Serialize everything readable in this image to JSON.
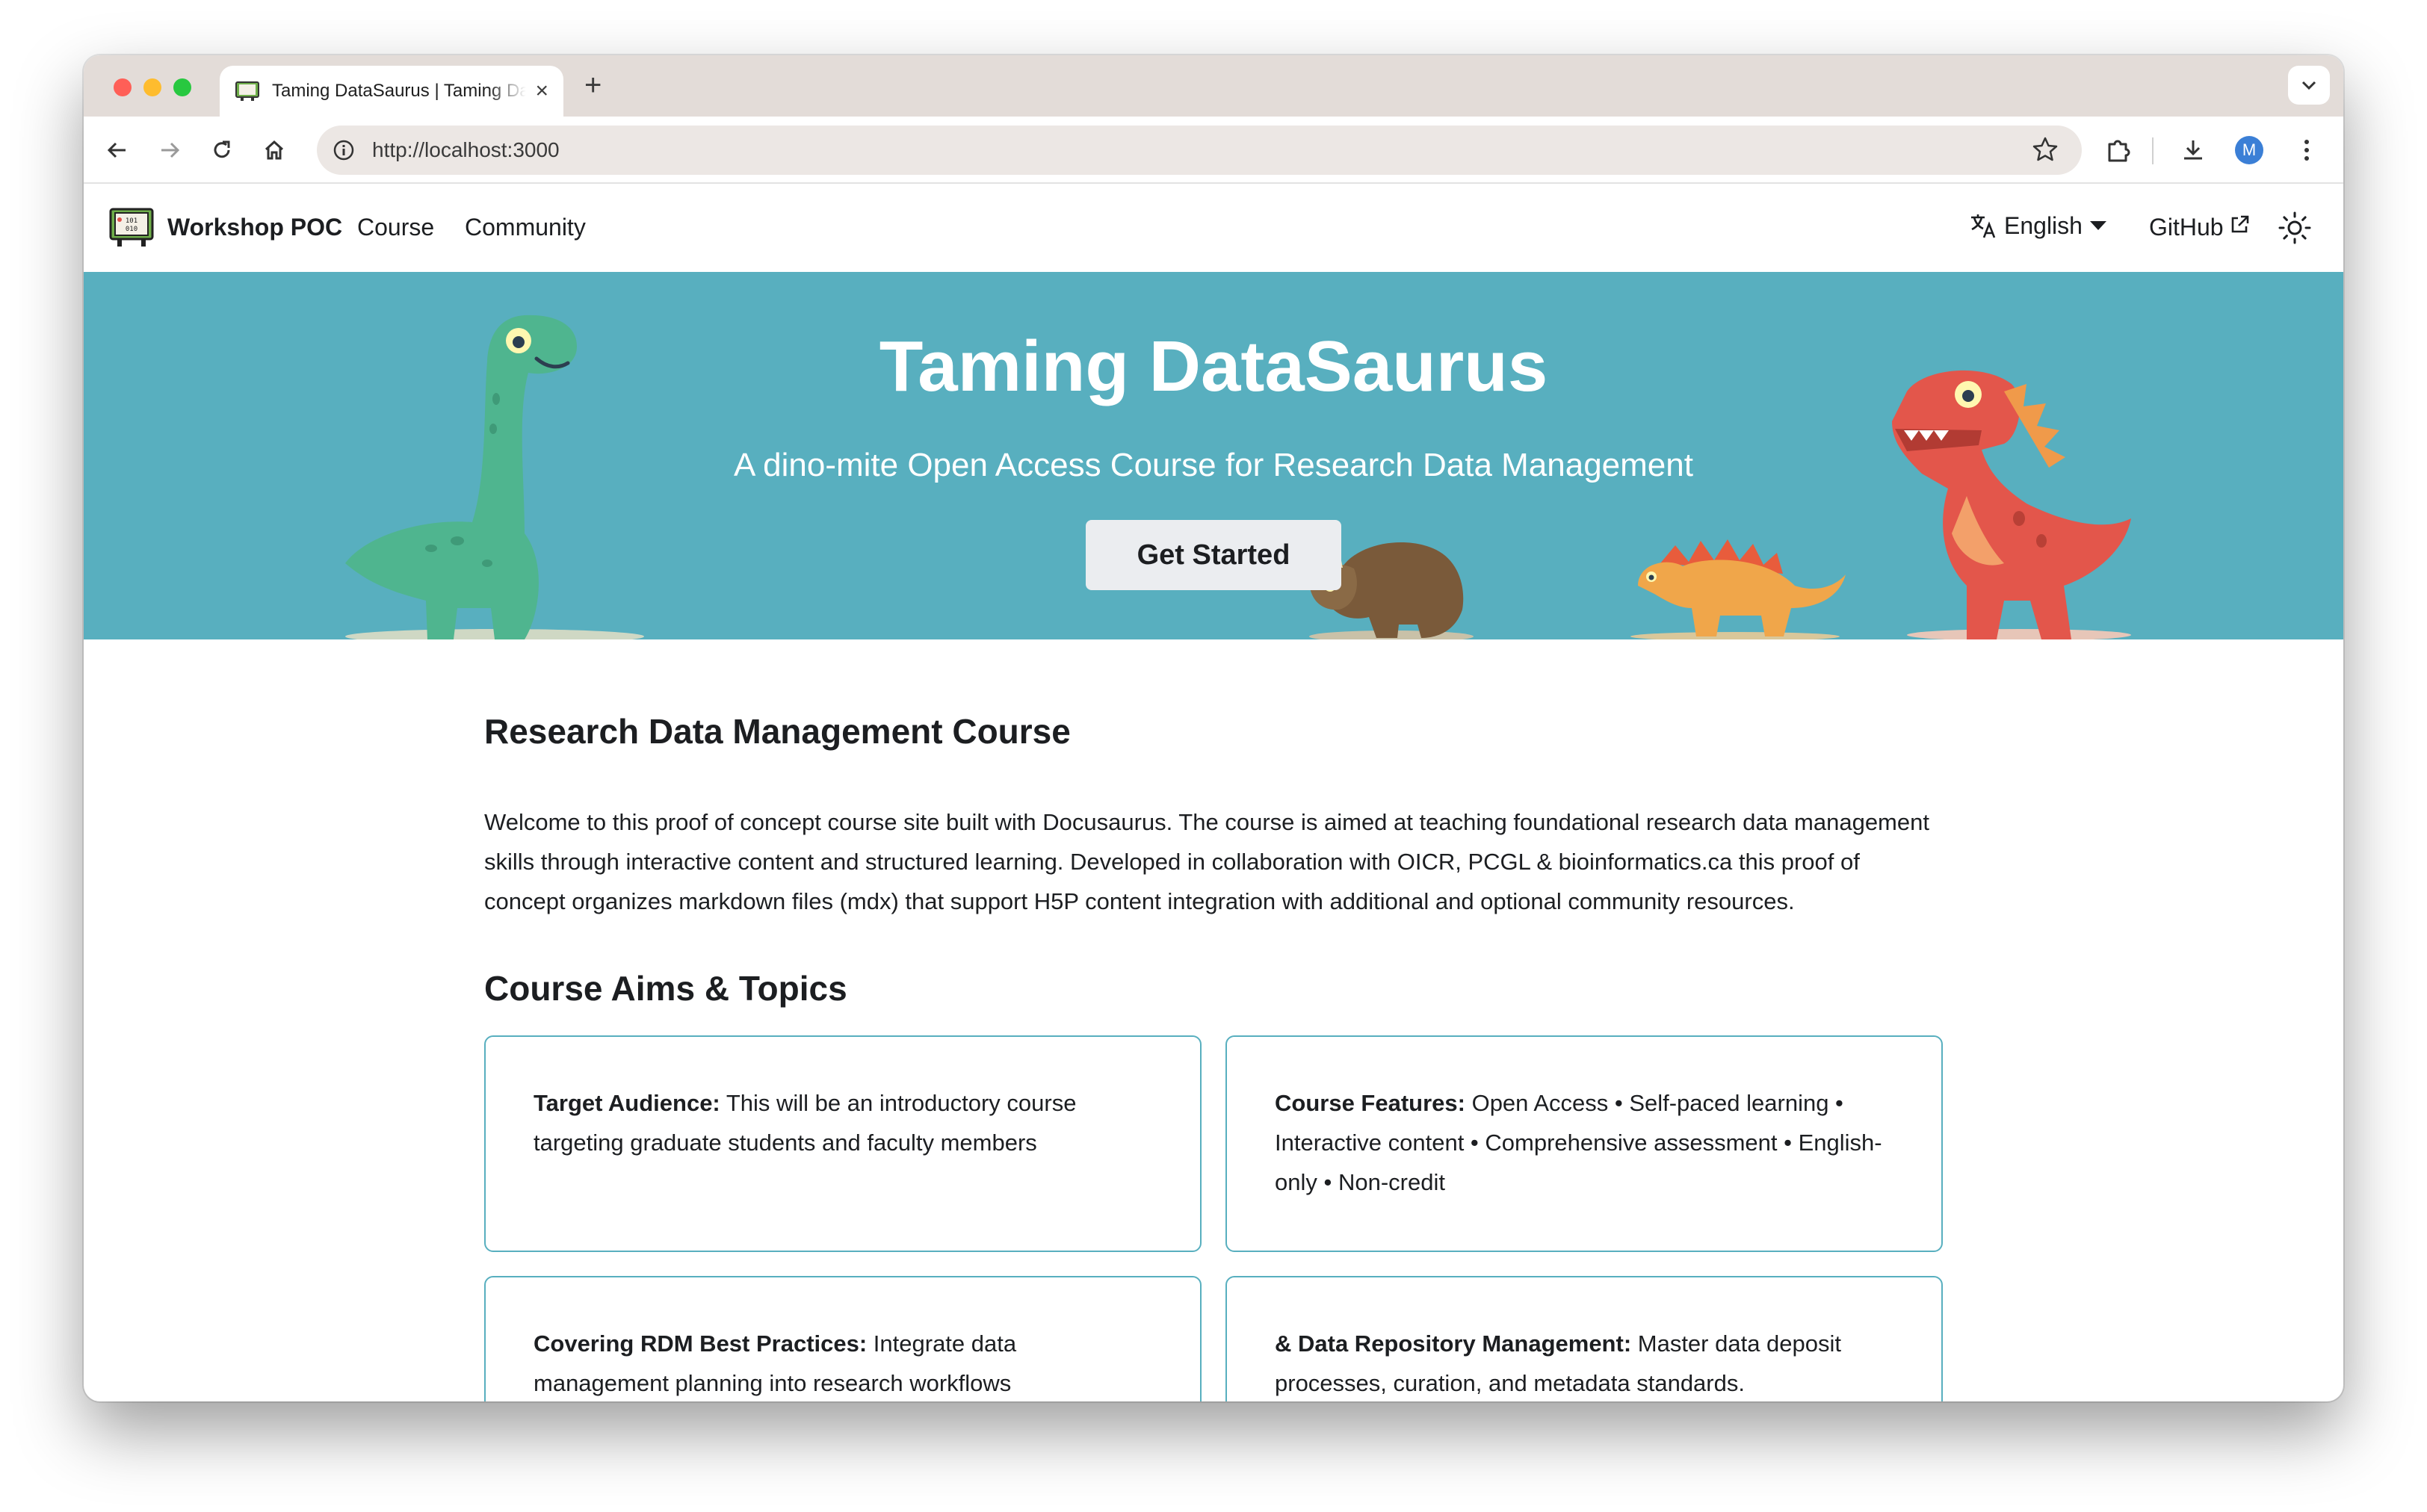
{
  "browser": {
    "tab_title": "Taming DataSaurus | Taming DataSaurus",
    "tab_close": "×",
    "new_tab": "+",
    "url": "http://localhost:3000",
    "profile_initial": "M"
  },
  "navbar": {
    "brand": "Workshop POC",
    "links": [
      "Course",
      "Community"
    ],
    "language": "English",
    "github": "GitHub"
  },
  "hero": {
    "title": "Taming DataSaurus",
    "subtitle": "A dino-mite Open Access Course for Research Data Management",
    "cta": "Get Started",
    "color": "#58afbf"
  },
  "content": {
    "heading": "Research Data Management Course",
    "intro": "Welcome to this proof of concept course site built with Docusaurus. The course is aimed at teaching foundational research data management skills through interactive content and structured learning. Developed in collaboration with OICR, PCGL & bioinformatics.ca this proof of concept organizes markdown files (mdx) that support H5P content integration with additional and optional community resources.",
    "aims_heading": "Course Aims & Topics",
    "cards": [
      {
        "label": "Target Audience:",
        "text": " This will be an introductory course targeting graduate students and faculty members"
      },
      {
        "label": "Course Features:",
        "text": " Open Access • Self-paced learning • Interactive content • Comprehensive assessment • English-only • Non-credit"
      },
      {
        "label": "Covering RDM Best Practices:",
        "text": " Integrate data management planning into research workflows"
      },
      {
        "label": "& Data Repository Management:",
        "text": " Master data deposit processes, curation, and metadata standards."
      }
    ]
  },
  "icons": [
    "back-icon",
    "forward-icon",
    "reload-icon",
    "home-icon",
    "info-icon",
    "star-icon",
    "extensions-icon",
    "download-icon",
    "kebab-menu-icon",
    "translate-icon",
    "external-link-icon",
    "sun-icon",
    "chevron-down-icon"
  ]
}
